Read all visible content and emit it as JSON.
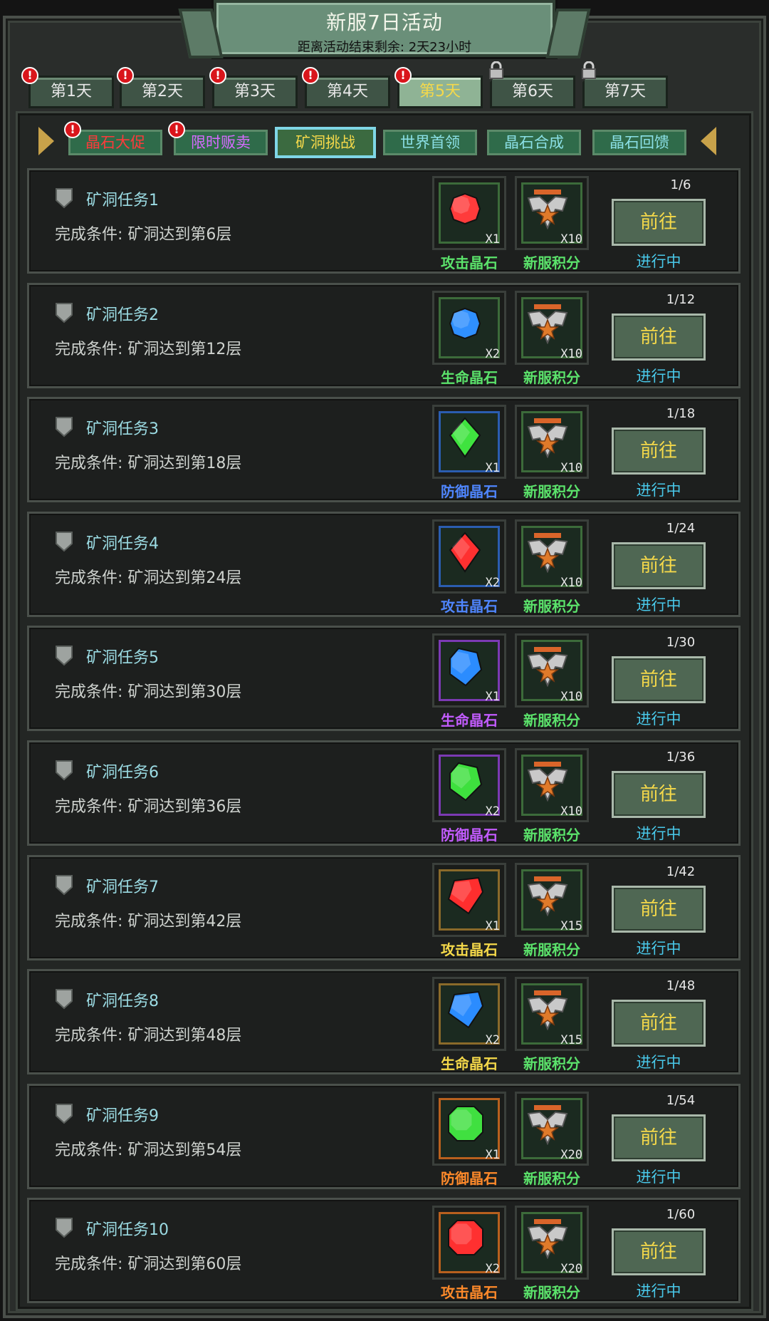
{
  "header": {
    "title": "新服7日活动",
    "subtitle": "距离活动结束剩余: 2天23小时"
  },
  "day_tabs": [
    {
      "label": "第1天",
      "badge": "!",
      "locked": false,
      "active": false
    },
    {
      "label": "第2天",
      "badge": "!",
      "locked": false,
      "active": false
    },
    {
      "label": "第3天",
      "badge": "!",
      "locked": false,
      "active": false
    },
    {
      "label": "第4天",
      "badge": "!",
      "locked": false,
      "active": false
    },
    {
      "label": "第5天",
      "badge": "!",
      "locked": false,
      "active": true
    },
    {
      "label": "第6天",
      "badge": "",
      "locked": true,
      "active": false
    },
    {
      "label": "第7天",
      "badge": "",
      "locked": true,
      "active": false
    }
  ],
  "sub_tabs": [
    {
      "label": "晶石大促",
      "badge": "!",
      "active": false
    },
    {
      "label": "限时贩卖",
      "badge": "!",
      "active": false
    },
    {
      "label": "矿洞挑战",
      "badge": "",
      "active": true
    },
    {
      "label": "世界首领",
      "badge": "",
      "active": false
    },
    {
      "label": "晶石合成",
      "badge": "",
      "active": false
    },
    {
      "label": "晶石回馈",
      "badge": "",
      "active": false
    }
  ],
  "tasks": [
    {
      "name": "矿洞任务1",
      "condition": "完成条件: 矿洞达到第6层",
      "progress": "1/6",
      "button": "前往",
      "status": "进行中",
      "reward": {
        "label": "攻击晶石",
        "qty": "X1",
        "gem": "red-round-gem-icon",
        "color": "#ff3b3b",
        "frame": "#3c6b3a",
        "label_color": "#5be36b"
      },
      "points": {
        "label": "新服积分",
        "qty": "X10"
      }
    },
    {
      "name": "矿洞任务2",
      "condition": "完成条件: 矿洞达到第12层",
      "progress": "1/12",
      "button": "前往",
      "status": "进行中",
      "reward": {
        "label": "生命晶石",
        "qty": "X2",
        "gem": "blue-round-gem-icon",
        "color": "#2f8fff",
        "frame": "#3c6b3a",
        "label_color": "#5be36b"
      },
      "points": {
        "label": "新服积分",
        "qty": "X10"
      }
    },
    {
      "name": "矿洞任务3",
      "condition": "完成条件: 矿洞达到第18层",
      "progress": "1/18",
      "button": "前往",
      "status": "进行中",
      "reward": {
        "label": "防御晶石",
        "qty": "X1",
        "gem": "green-diamond-gem-icon",
        "color": "#3fe33f",
        "frame": "#2b5db0",
        "label_color": "#4f86ff"
      },
      "points": {
        "label": "新服积分",
        "qty": "X10"
      }
    },
    {
      "name": "矿洞任务4",
      "condition": "完成条件: 矿洞达到第24层",
      "progress": "1/24",
      "button": "前往",
      "status": "进行中",
      "reward": {
        "label": "攻击晶石",
        "qty": "X2",
        "gem": "red-diamond-gem-icon",
        "color": "#ff3030",
        "frame": "#2b5db0",
        "label_color": "#4f86ff"
      },
      "points": {
        "label": "新服积分",
        "qty": "X10"
      }
    },
    {
      "name": "矿洞任务5",
      "condition": "完成条件: 矿洞达到第30层",
      "progress": "1/30",
      "button": "前往",
      "status": "进行中",
      "reward": {
        "label": "生命晶石",
        "qty": "X1",
        "gem": "blue-crystal-gem-icon",
        "color": "#2b8cff",
        "frame": "#7b3ab3",
        "label_color": "#c35cff"
      },
      "points": {
        "label": "新服积分",
        "qty": "X10"
      }
    },
    {
      "name": "矿洞任务6",
      "condition": "完成条件: 矿洞达到第36层",
      "progress": "1/36",
      "button": "前往",
      "status": "进行中",
      "reward": {
        "label": "防御晶石",
        "qty": "X2",
        "gem": "green-crystal-gem-icon",
        "color": "#3ee03e",
        "frame": "#7b3ab3",
        "label_color": "#c35cff"
      },
      "points": {
        "label": "新服积分",
        "qty": "X10"
      }
    },
    {
      "name": "矿洞任务7",
      "condition": "完成条件: 矿洞达到第42层",
      "progress": "1/42",
      "button": "前往",
      "status": "进行中",
      "reward": {
        "label": "攻击晶石",
        "qty": "X1",
        "gem": "red-cut-gem-icon",
        "color": "#ff2e2e",
        "frame": "#8a6a2a",
        "label_color": "#f5d94a"
      },
      "points": {
        "label": "新服积分",
        "qty": "X15"
      }
    },
    {
      "name": "矿洞任务8",
      "condition": "完成条件: 矿洞达到第48层",
      "progress": "1/48",
      "button": "前往",
      "status": "进行中",
      "reward": {
        "label": "生命晶石",
        "qty": "X2",
        "gem": "blue-cut-gem-icon",
        "color": "#2b8cff",
        "frame": "#8a6a2a",
        "label_color": "#f5d94a"
      },
      "points": {
        "label": "新服积分",
        "qty": "X15"
      }
    },
    {
      "name": "矿洞任务9",
      "condition": "完成条件: 矿洞达到第54层",
      "progress": "1/54",
      "button": "前往",
      "status": "进行中",
      "reward": {
        "label": "防御晶石",
        "qty": "X1",
        "gem": "green-octagon-gem-icon",
        "color": "#40e040",
        "frame": "#b8601e",
        "label_color": "#ff8a2a"
      },
      "points": {
        "label": "新服积分",
        "qty": "X20"
      }
    },
    {
      "name": "矿洞任务10",
      "condition": "完成条件: 矿洞达到第60层",
      "progress": "1/60",
      "button": "前往",
      "status": "进行中",
      "reward": {
        "label": "攻击晶石",
        "qty": "X2",
        "gem": "red-octagon-gem-icon",
        "color": "#ff3030",
        "frame": "#b8601e",
        "label_color": "#ff8a2a"
      },
      "points": {
        "label": "新服积分",
        "qty": "X20"
      }
    }
  ],
  "colors": {
    "points_label": "#5be36b",
    "status": "#49c9ea",
    "button_text": "#f5d94a"
  }
}
